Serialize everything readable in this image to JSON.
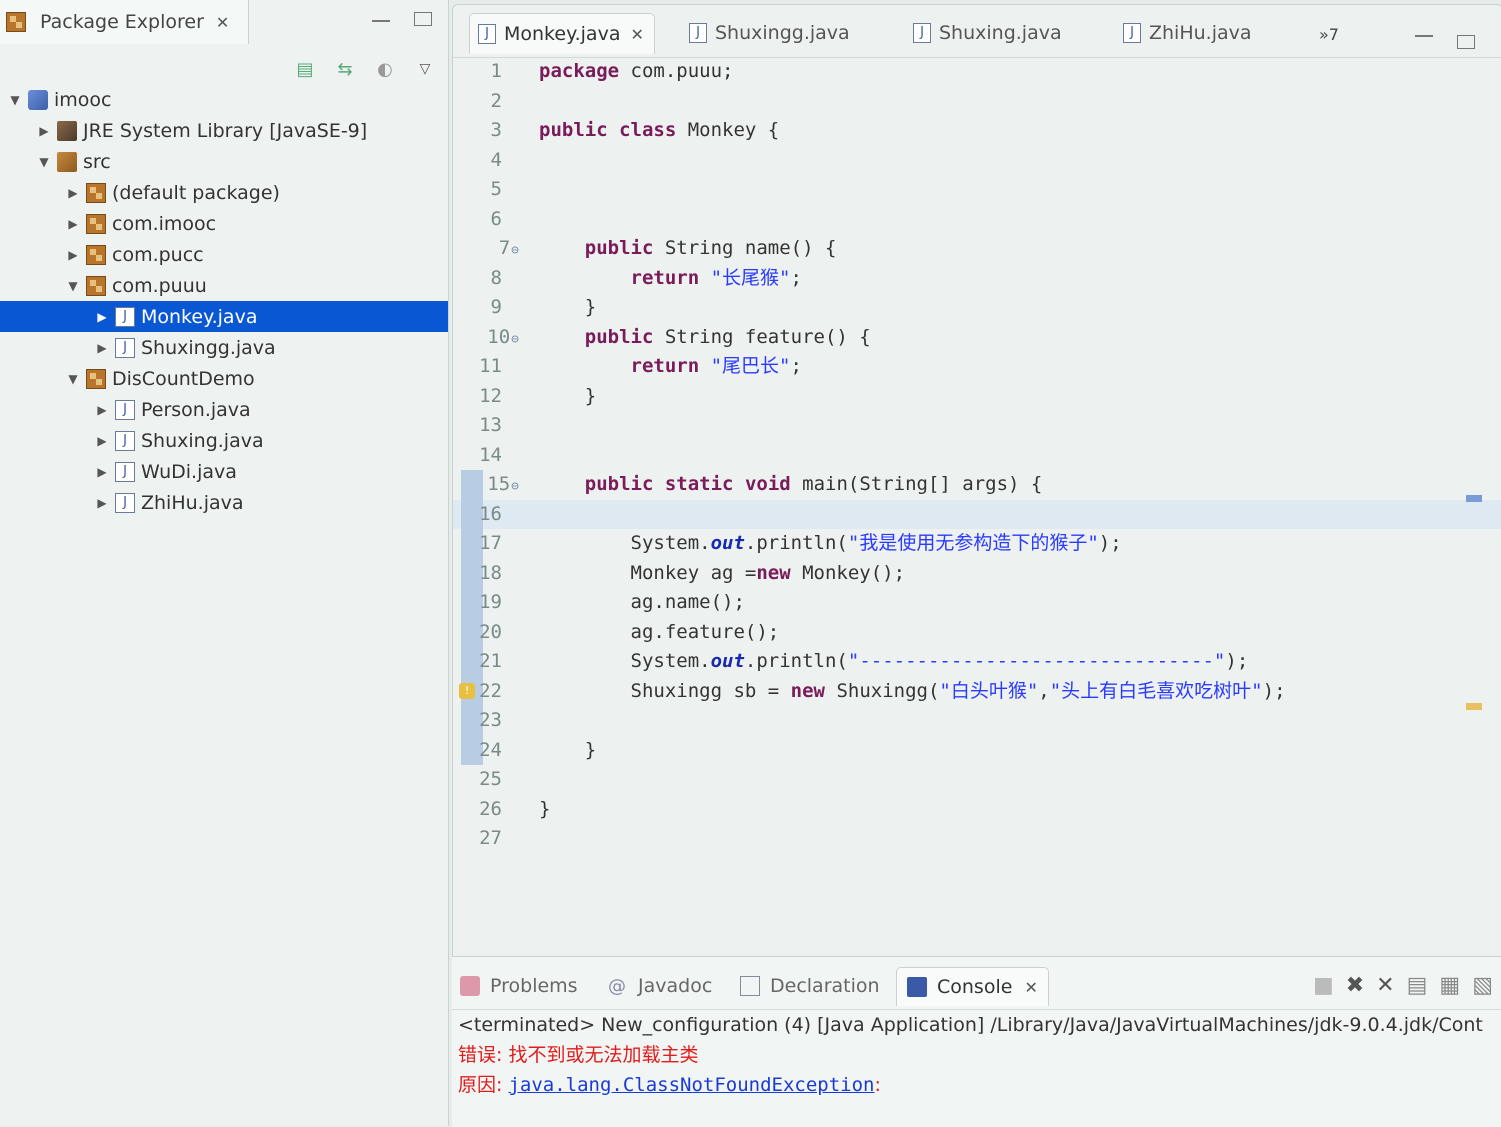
{
  "explorer": {
    "title": "Package Explorer",
    "tree": [
      {
        "twisty": "▼",
        "icon": "project",
        "label": "imooc",
        "indent": 0
      },
      {
        "twisty": "▶",
        "icon": "jre",
        "label": "JRE System Library [JavaSE-9]",
        "indent": 1
      },
      {
        "twisty": "▼",
        "icon": "src",
        "label": "src",
        "indent": 1
      },
      {
        "twisty": "▶",
        "icon": "pkg",
        "label": "(default package)",
        "indent": 2
      },
      {
        "twisty": "▶",
        "icon": "pkg",
        "label": "com.imooc",
        "indent": 2
      },
      {
        "twisty": "▶",
        "icon": "pkg",
        "label": "com.pucc",
        "indent": 2
      },
      {
        "twisty": "▼",
        "icon": "pkg",
        "label": "com.puuu",
        "indent": 2
      },
      {
        "twisty": "▶",
        "icon": "java",
        "label": "Monkey.java",
        "indent": 3,
        "selected": true
      },
      {
        "twisty": "▶",
        "icon": "java",
        "label": "Shuxingg.java",
        "indent": 3
      },
      {
        "twisty": "▼",
        "icon": "pkg",
        "label": "DisCountDemo",
        "indent": 2
      },
      {
        "twisty": "▶",
        "icon": "java",
        "label": "Person.java",
        "indent": 3
      },
      {
        "twisty": "▶",
        "icon": "java",
        "label": "Shuxing.java",
        "indent": 3
      },
      {
        "twisty": "▶",
        "icon": "java",
        "label": "WuDi.java",
        "indent": 3
      },
      {
        "twisty": "▶",
        "icon": "java",
        "label": "ZhiHu.java",
        "indent": 3
      }
    ]
  },
  "editor": {
    "tabs": [
      {
        "label": "Monkey.java",
        "active": true
      },
      {
        "label": "Shuxingg.java"
      },
      {
        "label": "Shuxing.java"
      },
      {
        "label": "ZhiHu.java"
      }
    ],
    "overflow_label": "»7",
    "lines": [
      {
        "n": "1",
        "html": "<span class='kw'>package</span> com.puuu;"
      },
      {
        "n": "2",
        "html": ""
      },
      {
        "n": "3",
        "html": "<span class='kw'>public</span> <span class='kw'>class</span> Monkey {"
      },
      {
        "n": "4",
        "html": ""
      },
      {
        "n": "5",
        "html": ""
      },
      {
        "n": "6",
        "html": ""
      },
      {
        "n": "7",
        "fold": true,
        "html": "    <span class='kw'>public</span> String name() {"
      },
      {
        "n": "8",
        "html": "        <span class='kw'>return</span> <span class='str'>\"长尾猴\"</span>;"
      },
      {
        "n": "9",
        "html": "    }"
      },
      {
        "n": "10",
        "fold": true,
        "html": "    <span class='kw'>public</span> String feature() {"
      },
      {
        "n": "11",
        "html": "        <span class='kw'>return</span> <span class='str'>\"尾巴长\"</span>;"
      },
      {
        "n": "12",
        "html": "    }"
      },
      {
        "n": "13",
        "html": ""
      },
      {
        "n": "14",
        "html": ""
      },
      {
        "n": "15",
        "fold": true,
        "bar": true,
        "html": "    <span class='kw'>public</span> <span class='kw'>static</span> <span class='kw'>void</span> main(String[] args) {"
      },
      {
        "n": "16",
        "bar": true,
        "current": true,
        "html": ""
      },
      {
        "n": "17",
        "bar": true,
        "html": "        System.<span class='fld'>out</span>.println(<span class='str'>\"我是使用无参构造下的猴子\"</span>);"
      },
      {
        "n": "18",
        "bar": true,
        "html": "        Monkey ag =<span class='kw'>new</span> Monkey();"
      },
      {
        "n": "19",
        "bar": true,
        "html": "        ag.name();"
      },
      {
        "n": "20",
        "bar": true,
        "html": "        ag.feature();"
      },
      {
        "n": "21",
        "bar": true,
        "html": "        System.<span class='fld'>out</span>.println(<span class='str'>\"-------------------------------\"</span>);"
      },
      {
        "n": "22",
        "bar": true,
        "warn": true,
        "html": "        Shuxingg sb = <span class='kw'>new</span> Shuxingg(<span class='str'>\"白头叶猴\"</span>,<span class='str'>\"头上有白毛喜欢吃树叶\"</span>);"
      },
      {
        "n": "23",
        "bar": true,
        "html": ""
      },
      {
        "n": "24",
        "bar": true,
        "html": "    }"
      },
      {
        "n": "25",
        "html": ""
      },
      {
        "n": "26",
        "html": "}"
      },
      {
        "n": "27",
        "html": ""
      }
    ]
  },
  "console": {
    "tabs": [
      "Problems",
      "Javadoc",
      "Declaration",
      "Console"
    ],
    "active_tab": "Console",
    "terminated_line": "<terminated> New_configuration (4) [Java Application] /Library/Java/JavaVirtualMachines/jdk-9.0.4.jdk/Cont",
    "error_line": "错误: 找不到或无法加载主类",
    "cause_prefix": "原因: ",
    "cause_link": "java.lang.ClassNotFoundException",
    "cause_suffix": ":"
  },
  "colors": {
    "selection": "#0a57d4",
    "keyword": "#7a1b5a",
    "string": "#2a3aff",
    "error": "#e21c1c"
  }
}
